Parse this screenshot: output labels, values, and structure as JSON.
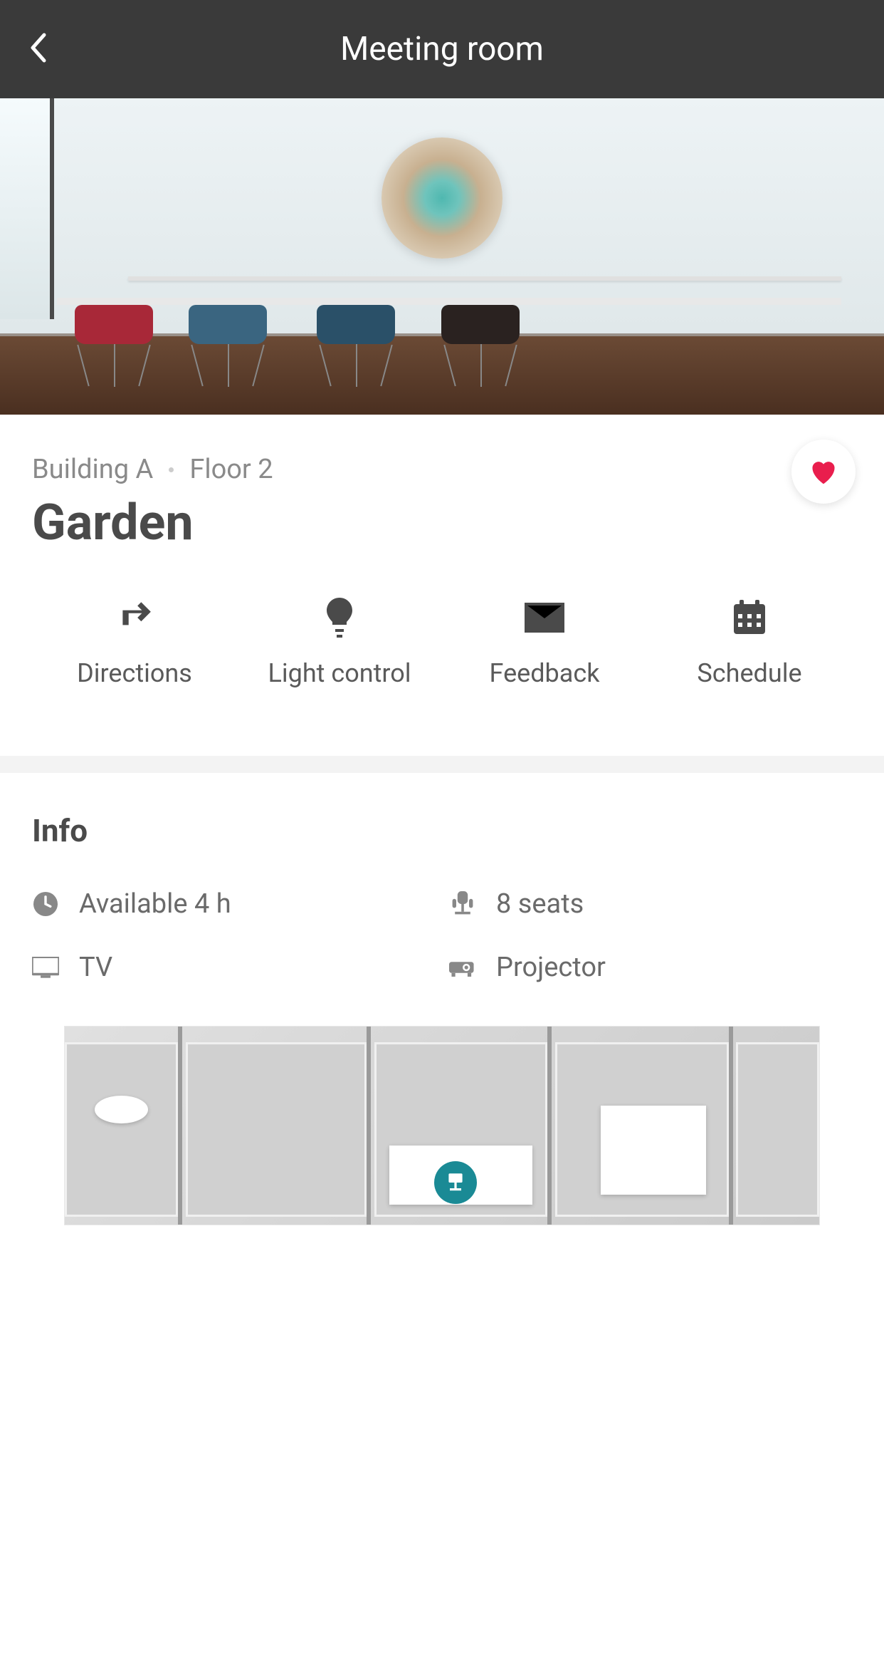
{
  "header": {
    "title": "Meeting room"
  },
  "room": {
    "building": "Building A",
    "floor": "Floor 2",
    "name": "Garden"
  },
  "actions": [
    {
      "label": "Directions",
      "icon": "directions-icon"
    },
    {
      "label": "Light control",
      "icon": "lightbulb-icon"
    },
    {
      "label": "Feedback",
      "icon": "envelope-icon"
    },
    {
      "label": "Schedule",
      "icon": "calendar-icon"
    }
  ],
  "info": {
    "title": "Info",
    "items": [
      {
        "icon": "clock-icon",
        "text": "Available 4 h"
      },
      {
        "icon": "seat-icon",
        "text": "8 seats"
      },
      {
        "icon": "tv-icon",
        "text": "TV"
      },
      {
        "icon": "projector-icon",
        "text": "Projector"
      }
    ]
  },
  "colors": {
    "accent": "#e91e4d",
    "pin": "#1a8a95"
  }
}
